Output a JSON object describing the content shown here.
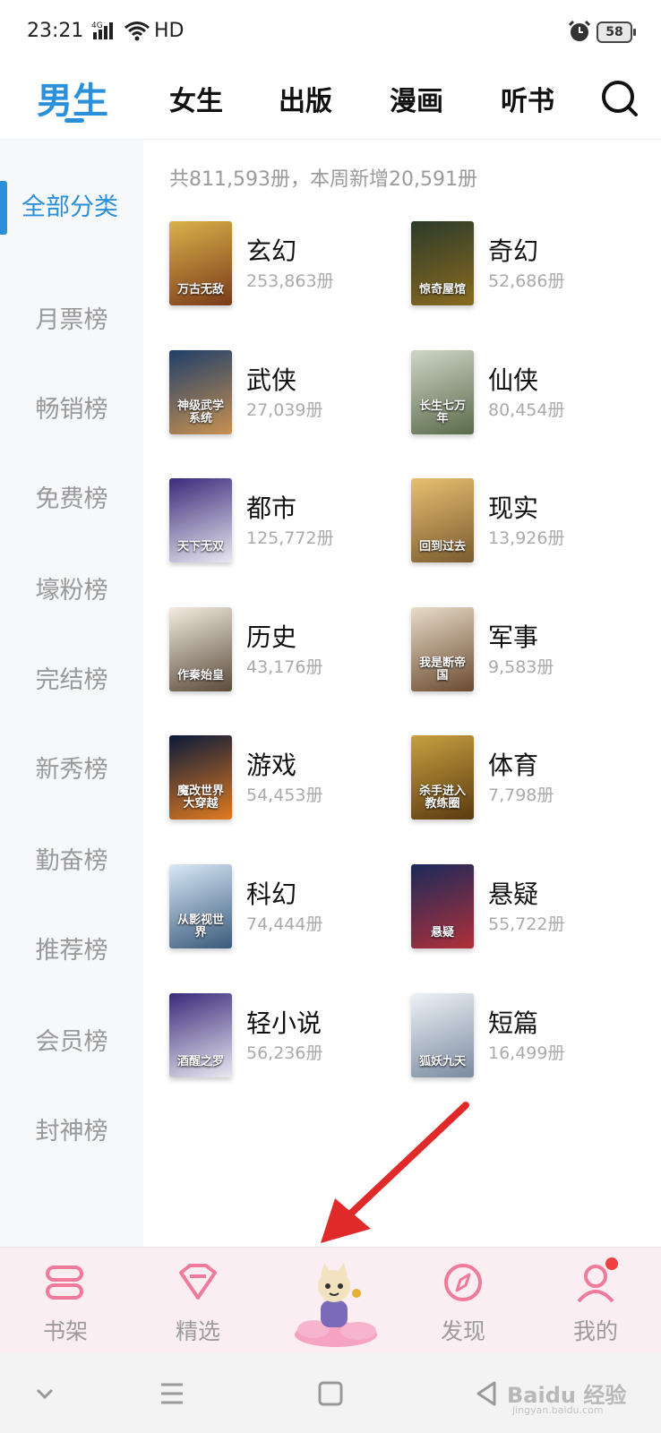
{
  "status_bar": {
    "time": "23:21",
    "network": "4G",
    "hd": "HD",
    "battery": "58"
  },
  "top_nav": {
    "tabs": [
      {
        "label": "男生",
        "active": true
      },
      {
        "label": "女生"
      },
      {
        "label": "出版"
      },
      {
        "label": "漫画"
      },
      {
        "label": "听书"
      }
    ],
    "search_icon": "search-icon"
  },
  "sidebar": {
    "items": [
      {
        "label": "全部分类",
        "active": true
      },
      {
        "label": "月票榜"
      },
      {
        "label": "畅销榜"
      },
      {
        "label": "免费榜"
      },
      {
        "label": "壕粉榜"
      },
      {
        "label": "完结榜"
      },
      {
        "label": "新秀榜"
      },
      {
        "label": "勤奋榜"
      },
      {
        "label": "推荐榜"
      },
      {
        "label": "会员榜"
      },
      {
        "label": "封神榜"
      }
    ]
  },
  "content": {
    "summary": "共811,593册，本周新增20,591册",
    "categories": [
      {
        "name": "玄幻",
        "count": "253,863册",
        "cover_text": "万古无敌",
        "cover_colors": [
          "#d9b24a",
          "#7a3a1a"
        ]
      },
      {
        "name": "奇幻",
        "count": "52,686册",
        "cover_text": "惊奇屋馆",
        "cover_colors": [
          "#2b3b2a",
          "#8a6a20"
        ]
      },
      {
        "name": "武侠",
        "count": "27,039册",
        "cover_text": "神级武学系统",
        "cover_colors": [
          "#1f3f6a",
          "#c89050"
        ]
      },
      {
        "name": "仙侠",
        "count": "80,454册",
        "cover_text": "长生七万年",
        "cover_colors": [
          "#cfd6c8",
          "#5a6a4a"
        ]
      },
      {
        "name": "都市",
        "count": "125,772册",
        "cover_text": "天下无双",
        "cover_colors": [
          "#3a2a7a",
          "#e8e8f0"
        ]
      },
      {
        "name": "现实",
        "count": "13,926册",
        "cover_text": "回到过去",
        "cover_colors": [
          "#e8c070",
          "#7a5a30"
        ]
      },
      {
        "name": "历史",
        "count": "43,176册",
        "cover_text": "作秦始皇",
        "cover_colors": [
          "#f2ece0",
          "#5a4a3a"
        ]
      },
      {
        "name": "军事",
        "count": "9,583册",
        "cover_text": "我是断帝国",
        "cover_colors": [
          "#e8dcc8",
          "#6a4a30"
        ]
      },
      {
        "name": "游戏",
        "count": "54,453册",
        "cover_text": "魔改世界大穿越",
        "cover_colors": [
          "#0a1a3a",
          "#e07a20"
        ]
      },
      {
        "name": "体育",
        "count": "7,798册",
        "cover_text": "杀手进入教练圈",
        "cover_colors": [
          "#c8a040",
          "#5a3a10"
        ]
      },
      {
        "name": "科幻",
        "count": "74,444册",
        "cover_text": "从影视世界",
        "cover_colors": [
          "#d8e8f8",
          "#3a5a7a"
        ]
      },
      {
        "name": "悬疑",
        "count": "55,722册",
        "cover_text": "悬疑",
        "cover_colors": [
          "#1a2a5a",
          "#b0303a"
        ]
      },
      {
        "name": "轻小说",
        "count": "56,236册",
        "cover_text": "酒醒之罗",
        "cover_colors": [
          "#3a2a7a",
          "#e8e8f0"
        ]
      },
      {
        "name": "短篇",
        "count": "16,499册",
        "cover_text": "狐妖九天",
        "cover_colors": [
          "#eef2f6",
          "#7a8aa0"
        ]
      }
    ]
  },
  "bottom_nav": {
    "items": [
      {
        "label": "书架",
        "icon": "bookshelf-icon"
      },
      {
        "label": "精选",
        "icon": "diamond-icon"
      },
      {
        "label": "",
        "icon": "mascot-icon"
      },
      {
        "label": "发现",
        "icon": "compass-icon"
      },
      {
        "label": "我的",
        "icon": "profile-icon"
      }
    ],
    "accent": "#f07a9a"
  },
  "system_bar": {
    "watermark": "Baidu 经验",
    "watermark_sub": "jingyan.baidu.com"
  },
  "colors": {
    "accent": "#2b90d9",
    "sidebar_bg": "#f7f8fa",
    "muted": "#999999"
  }
}
